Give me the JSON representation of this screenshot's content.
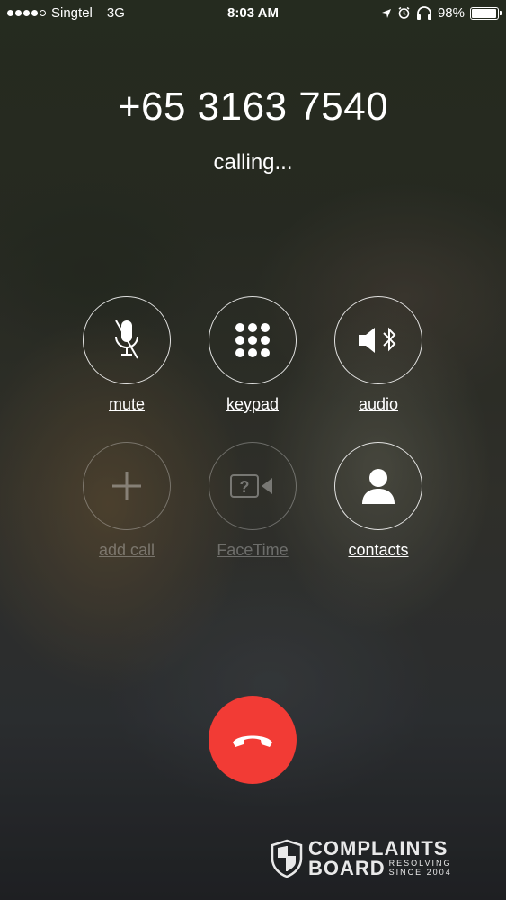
{
  "status_bar": {
    "carrier": "Singtel",
    "network": "3G",
    "time": "8:03 AM",
    "battery": "98%",
    "battery_level": 0.98,
    "signal_bars": 4
  },
  "call": {
    "number": "+65 3163 7540",
    "status": "calling..."
  },
  "buttons": {
    "mute": "mute",
    "keypad": "keypad",
    "audio": "audio",
    "add_call": "add call",
    "facetime": "FaceTime",
    "contacts": "contacts"
  },
  "watermark": {
    "line1": "COMPLAINTS",
    "line2": "BOARD",
    "tag1": "RESOLVING",
    "tag2": "SINCE 2004"
  },
  "colors": {
    "end_call": "#f23b35"
  }
}
